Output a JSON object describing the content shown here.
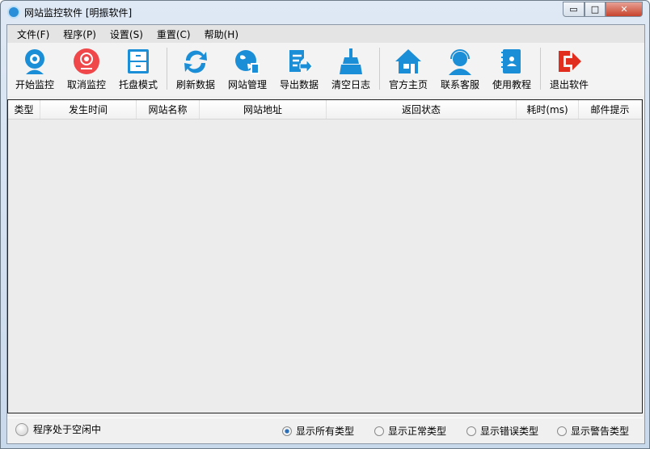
{
  "window": {
    "title": "网站监控软件 [明振软件]",
    "min": "▭",
    "max": "□",
    "close": "✕"
  },
  "menu": [
    "文件(F)",
    "程序(P)",
    "设置(S)",
    "重置(C)",
    "帮助(H)"
  ],
  "toolbar": [
    {
      "label": "开始监控",
      "icon": "webcam-icon",
      "color": "#1a8ed6"
    },
    {
      "label": "取消监控",
      "icon": "webcam-stop-icon",
      "color": "#f0474a"
    },
    {
      "label": "托盘模式",
      "icon": "cabinet-icon",
      "color": "#1a8ed6"
    },
    {
      "label": "刷新数据",
      "icon": "refresh-icon",
      "color": "#1a8ed6"
    },
    {
      "label": "网站管理",
      "icon": "globe-manage-icon",
      "color": "#1a8ed6"
    },
    {
      "label": "导出数据",
      "icon": "export-icon",
      "color": "#1a8ed6"
    },
    {
      "label": "清空日志",
      "icon": "broom-icon",
      "color": "#1a8ed6"
    },
    {
      "label": "官方主页",
      "icon": "home-icon",
      "color": "#1a8ed6"
    },
    {
      "label": "联系客服",
      "icon": "headset-icon",
      "color": "#1a8ed6"
    },
    {
      "label": "使用教程",
      "icon": "book-icon",
      "color": "#1a8ed6"
    },
    {
      "label": "退出软件",
      "icon": "exit-icon",
      "color": "#e02d1e"
    }
  ],
  "columns": [
    "类型",
    "发生时间",
    "网站名称",
    "网站地址",
    "返回状态",
    "耗时(ms)",
    "邮件提示"
  ],
  "status": {
    "text": "程序处于空闲中"
  },
  "filters": [
    {
      "label": "显示所有类型",
      "checked": true
    },
    {
      "label": "显示正常类型",
      "checked": false
    },
    {
      "label": "显示错误类型",
      "checked": false
    },
    {
      "label": "显示警告类型",
      "checked": false
    }
  ]
}
